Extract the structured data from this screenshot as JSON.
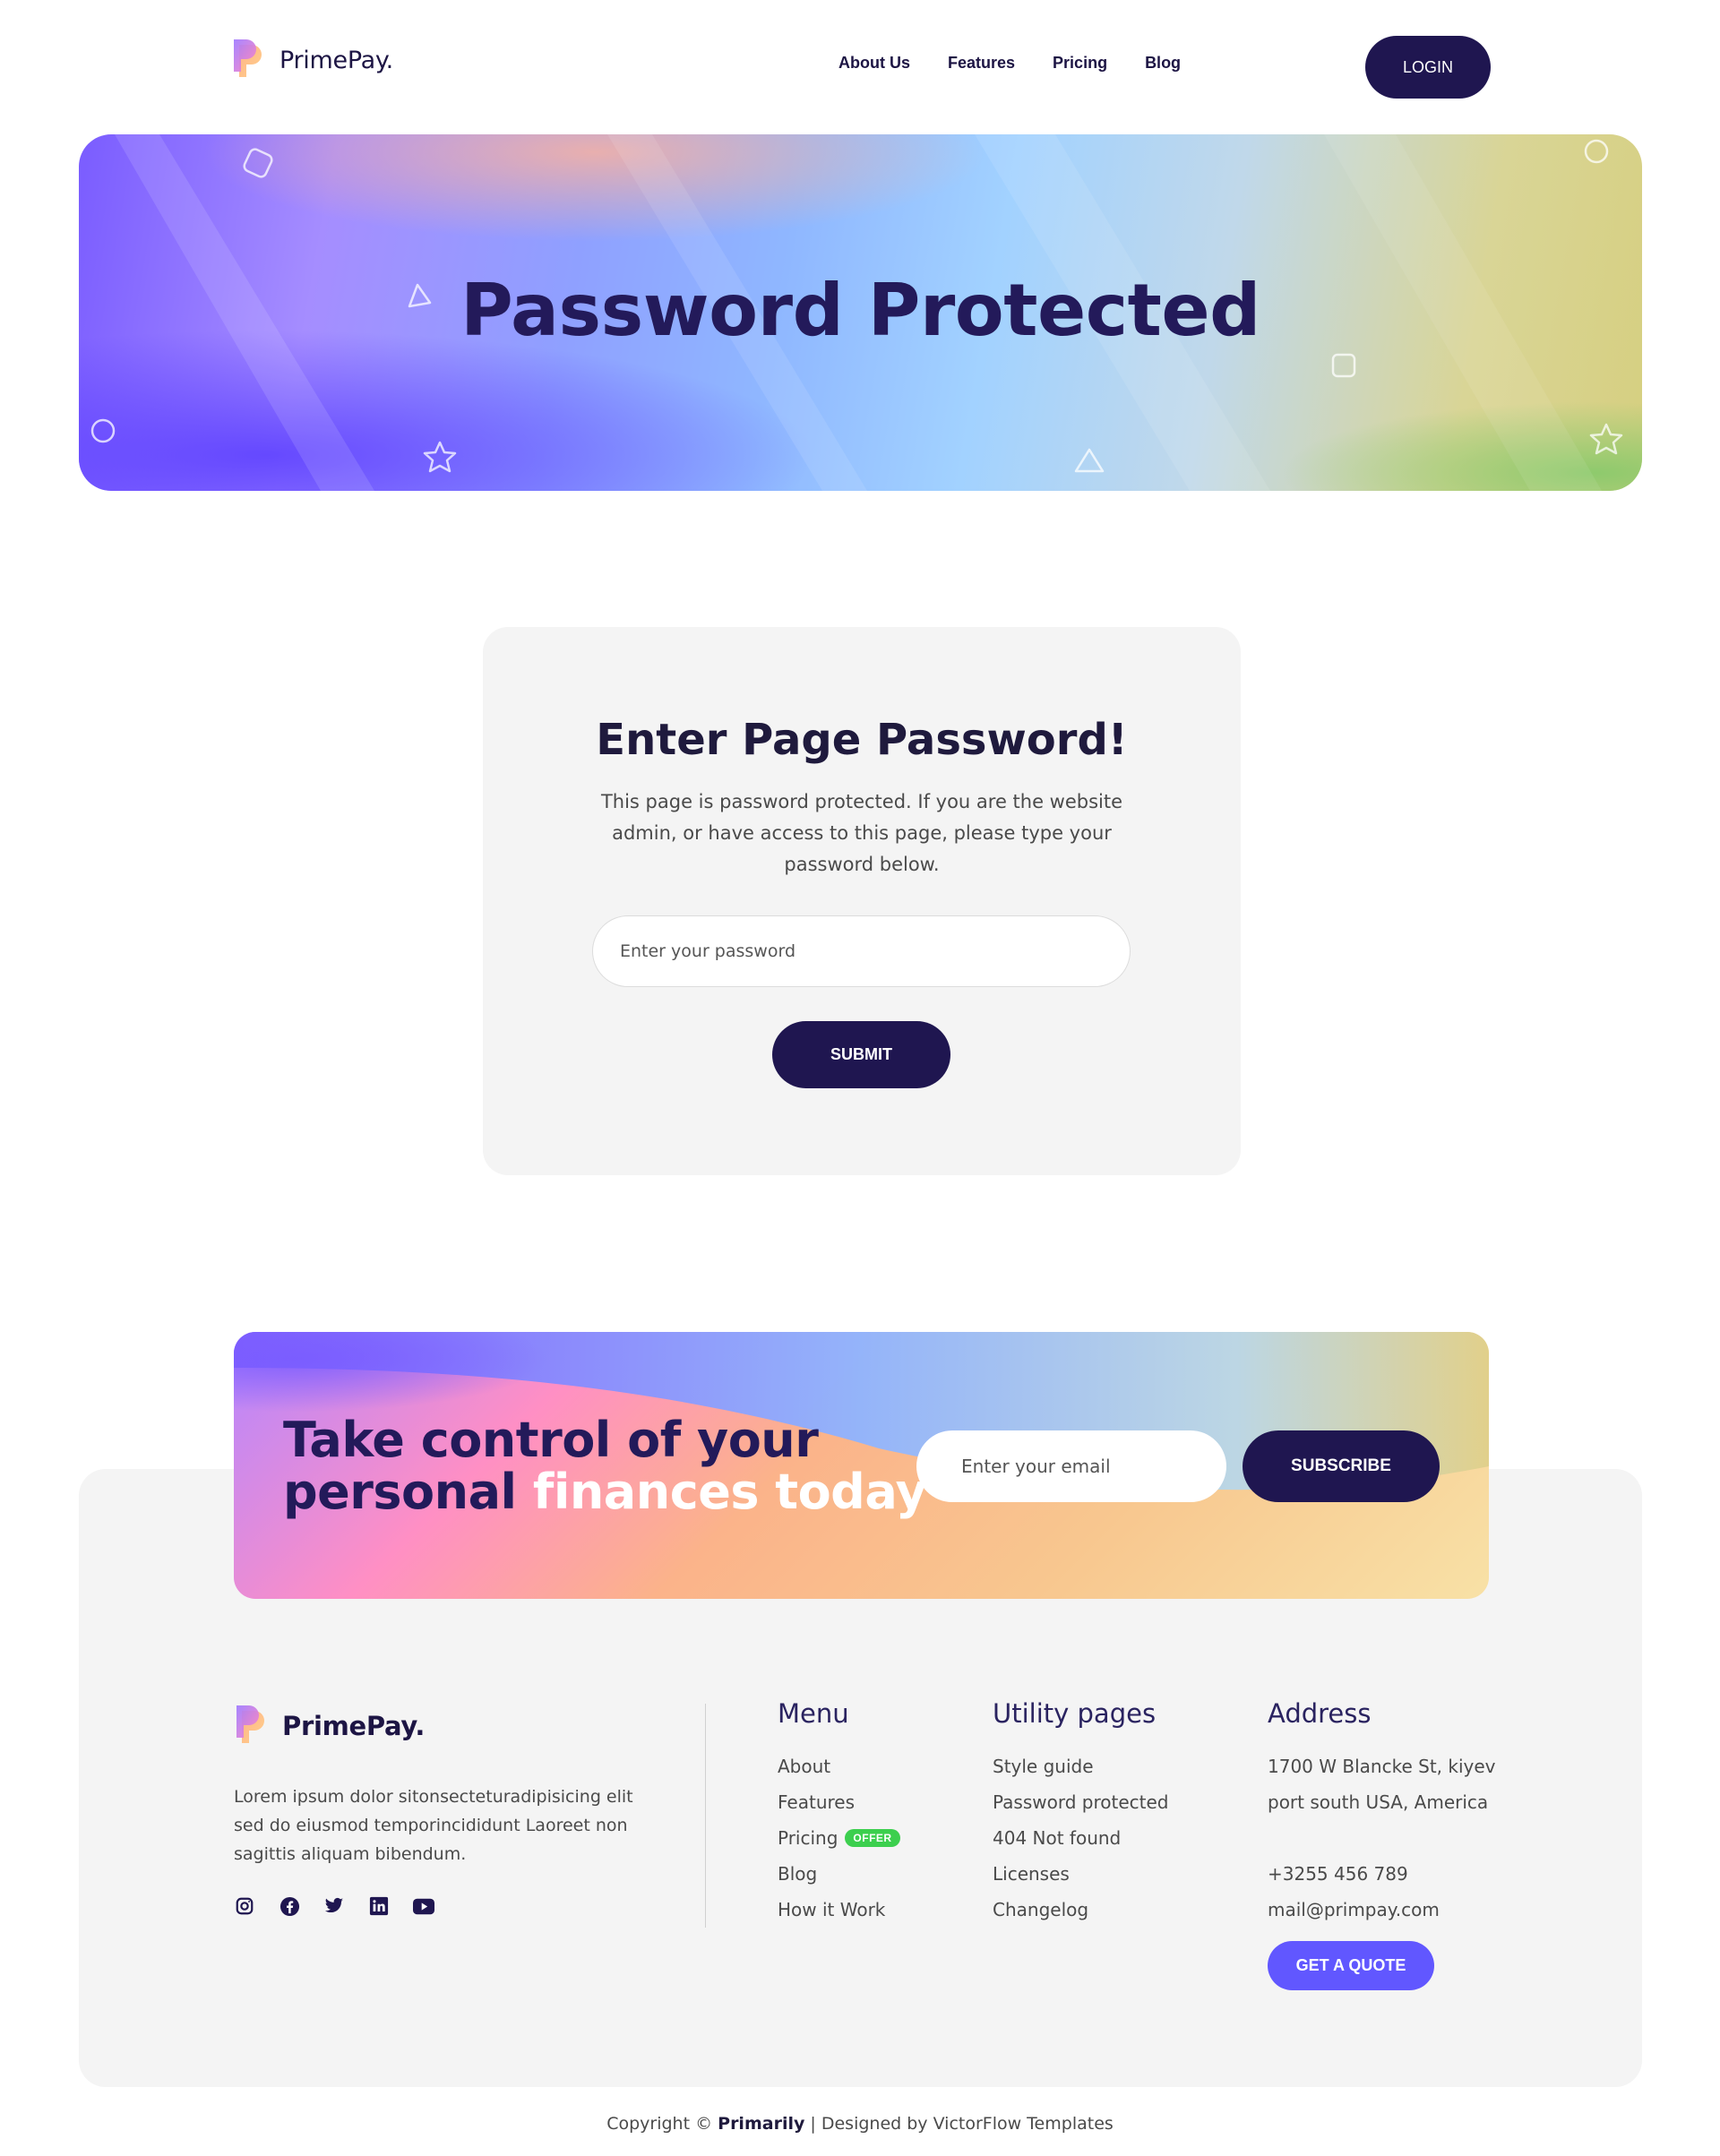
{
  "brand": {
    "name": "PrimePay."
  },
  "nav": {
    "items": [
      "About Us",
      "Features",
      "Pricing",
      "Blog"
    ],
    "login": "LOGIN"
  },
  "hero": {
    "title": "Password Protected"
  },
  "password_card": {
    "title": "Enter Page Password!",
    "description": "This page is password protected. If you are the website admin, or have access to this page, please type your password below.",
    "input_placeholder": "Enter your password",
    "submit": "SUBMIT"
  },
  "cta": {
    "title_dark_1": "Take control of your",
    "title_dark_2": "personal",
    "title_light": "finances today",
    "email_placeholder": "Enter your email",
    "subscribe": "SUBSCRIBE"
  },
  "footer": {
    "brand": "PrimePay.",
    "about": "Lorem ipsum dolor sitonsecteturadipisicing elit sed do eiusmod temporincididunt Laoreet non sagittis aliquam bibendum.",
    "socials": [
      "instagram-icon",
      "facebook-icon",
      "twitter-icon",
      "linkedin-icon",
      "youtube-icon"
    ],
    "menu": {
      "title": "Menu",
      "items": [
        "About",
        "Features",
        "Pricing",
        "Blog",
        "How it Work"
      ],
      "badge": "OFFER"
    },
    "utility": {
      "title": "Utility pages",
      "items": [
        "Style guide",
        "Password protected",
        "404 Not found",
        "Licenses",
        "Changelog"
      ]
    },
    "address": {
      "title": "Address",
      "line1": "1700 W Blancke St, kiyev",
      "line2": "port south USA, America",
      "phone": "+3255 456 789",
      "email": "mail@primpay.com",
      "quote": "GET A QUOTE"
    },
    "copyright_prefix": "Copyright ©",
    "copyright_brand": "Primarily",
    "copyright_suffix": "| Designed by VictorFlow Templates"
  },
  "colors": {
    "primary_dark": "#1f1650",
    "accent": "#6157ff",
    "badge_green": "#3ccf4e"
  }
}
